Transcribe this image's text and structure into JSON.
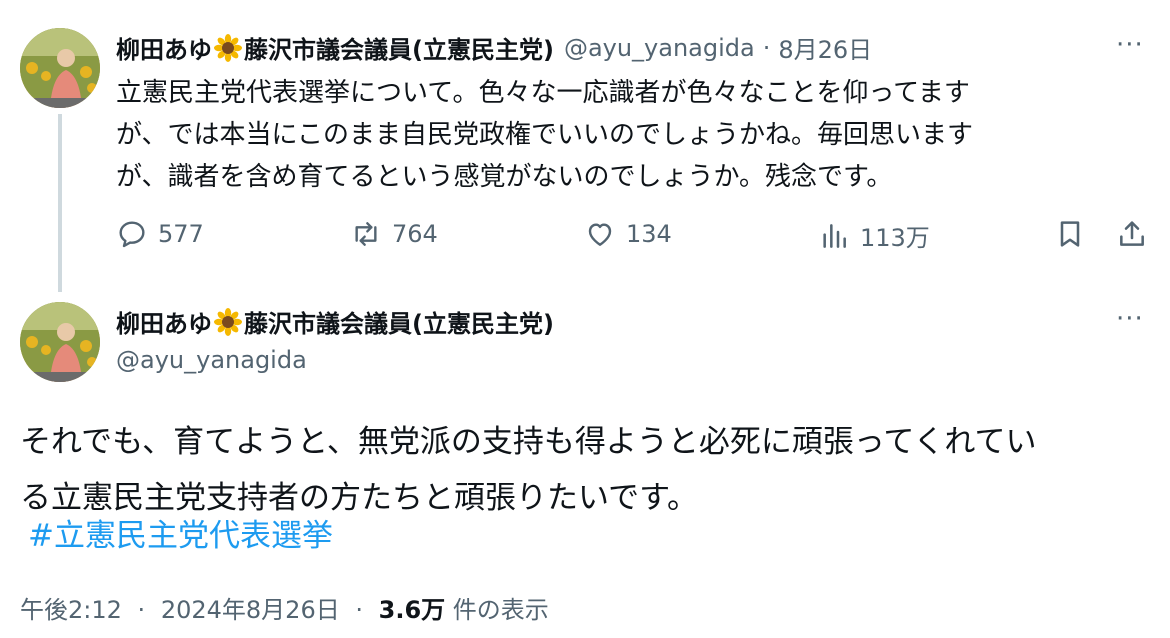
{
  "tweet1": {
    "display_name": "柳田あゆ",
    "name_suffix": "藤沢市議会議員(立憲民主党)",
    "handle": "@ayu_yanagida",
    "separator": "·",
    "date": "8月26日",
    "more_label": "···",
    "text_line1": "立憲民主党代表選挙について。色々な一応識者が色々なことを仰ってます",
    "text_line2": "が、では本当にこのまま自民党政権でいいのでしょうかね。毎回思います",
    "text_line3": "が、識者を含め育てるという感覚がないのでしょうか。残念です。",
    "replies": "577",
    "reposts": "764",
    "likes": "134",
    "views": "113万"
  },
  "tweet2": {
    "display_name": "柳田あゆ",
    "name_suffix": "藤沢市議会議員(立憲民主党)",
    "handle": "@ayu_yanagida",
    "more_label": "···",
    "text_line1": "それでも、育てようと、無党派の支持も得ようと必死に頑張ってくれてい",
    "text_line2": "る立憲民主党支持者の方たちと頑張りたいです。",
    "hashtag": "#立憲民主党代表選挙",
    "time": "午後2:12",
    "separator": "·",
    "full_date": "2024年8月26日",
    "views_count": "3.6万",
    "views_label": "件の表示"
  },
  "colors": {
    "text": "#0f1419",
    "secondary": "#536471",
    "link": "#1d9bf0",
    "thread_line": "#cfd9de"
  },
  "icons": [
    "sunflower-emoji",
    "more-icon",
    "reply-icon",
    "repost-icon",
    "like-icon",
    "views-icon",
    "bookmark-icon",
    "share-icon"
  ]
}
